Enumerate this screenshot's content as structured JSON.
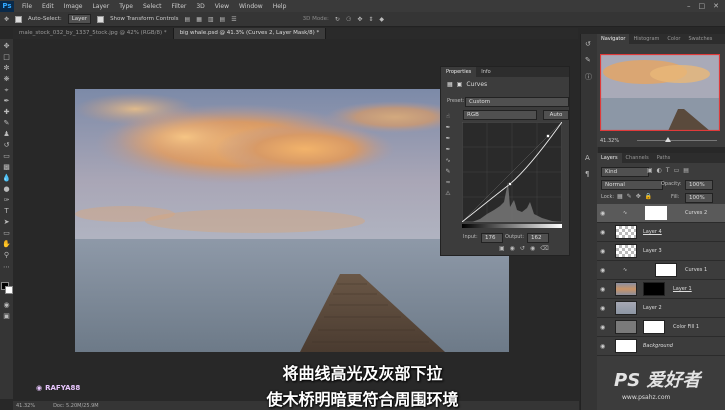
{
  "menu": {
    "logo": "Ps",
    "items": [
      "File",
      "Edit",
      "Image",
      "Layer",
      "Type",
      "Select",
      "Filter",
      "3D",
      "View",
      "Window",
      "Help"
    ]
  },
  "options": {
    "auto_select_label": "Auto-Select:",
    "auto_select_value": "Layer",
    "show_transform_label": "Show Transform Controls",
    "mode_label": "3D Mode:"
  },
  "tabs": [
    {
      "label": "male_stock_032_by_1337_5tock.jpg @ 42% (RGB/8) *"
    },
    {
      "label": "big whale.psd @ 41.3% (Curves 2, Layer Mask/8) *"
    }
  ],
  "properties": {
    "tab_active": "Properties",
    "tab_other": "Info",
    "title": "Curves",
    "preset_label": "Preset:",
    "preset_value": "Custom",
    "channel_value": "RGB",
    "auto_label": "Auto",
    "input_label": "Input:",
    "input_value": "176",
    "output_label": "Output:",
    "output_value": "162"
  },
  "navigator": {
    "tabs": [
      "Navigator",
      "Histogram",
      "Color",
      "Swatches"
    ],
    "zoom": "41.32%"
  },
  "layers_panel": {
    "tabs": [
      "Layers",
      "Channels",
      "Paths"
    ],
    "kind_value": "Kind",
    "blend_value": "Normal",
    "opacity_label": "Opacity:",
    "opacity_value": "100%",
    "lock_label": "Lock:",
    "fill_label": "Fill:",
    "fill_value": "100%",
    "layers": [
      {
        "name": "Curves 2"
      },
      {
        "name": "Layer 4"
      },
      {
        "name": "Layer 3"
      },
      {
        "name": "Curves 1"
      },
      {
        "name": "Layer 1"
      },
      {
        "name": "Layer 2"
      },
      {
        "name": "Color Fill 1"
      },
      {
        "name": "Background"
      }
    ]
  },
  "status": {
    "zoom": "41.32%",
    "doc": "Doc: 5.20M/25.9M"
  },
  "subtitles": {
    "line1": "将曲线高光及灰部下拉",
    "line2": "使木桥明暗更符合周围环境"
  },
  "brand": "RAFYA88",
  "watermark": {
    "text": "PS 爱好者",
    "url": "www.psahz.com"
  },
  "colors": {
    "accent": "#31a8ff",
    "subtitle": "#ffffff",
    "nav_frame": "#e03a3a"
  }
}
